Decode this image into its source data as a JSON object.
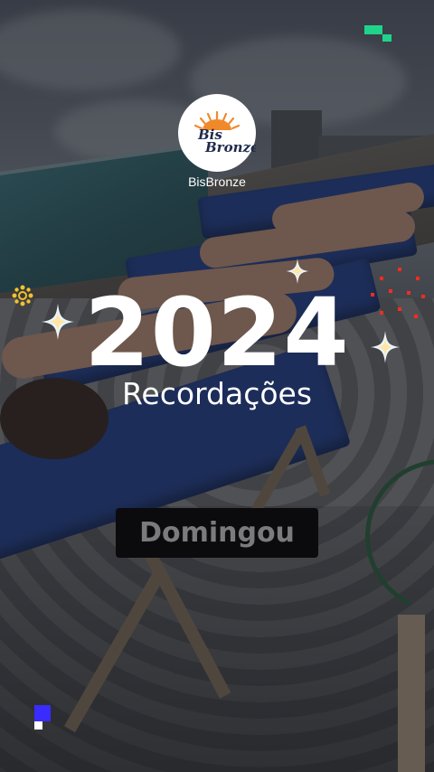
{
  "brand": {
    "name": "BisBronze",
    "logo_text_line1": "Bis",
    "logo_text_line2": "Bronze"
  },
  "headline": {
    "year": "2024",
    "subtitle": "Recordações"
  },
  "tag": {
    "label": "Domingou"
  },
  "colors": {
    "text": "#ffffff",
    "tag_background": "#0b0b0d",
    "tag_text": "#7b7b7e",
    "logo_accent_orange": "#f0892c",
    "logo_accent_navy": "#1f2a4d",
    "corner_pixel_green": "#1fd48a",
    "corner_pixel_blue": "#3a2bff"
  }
}
